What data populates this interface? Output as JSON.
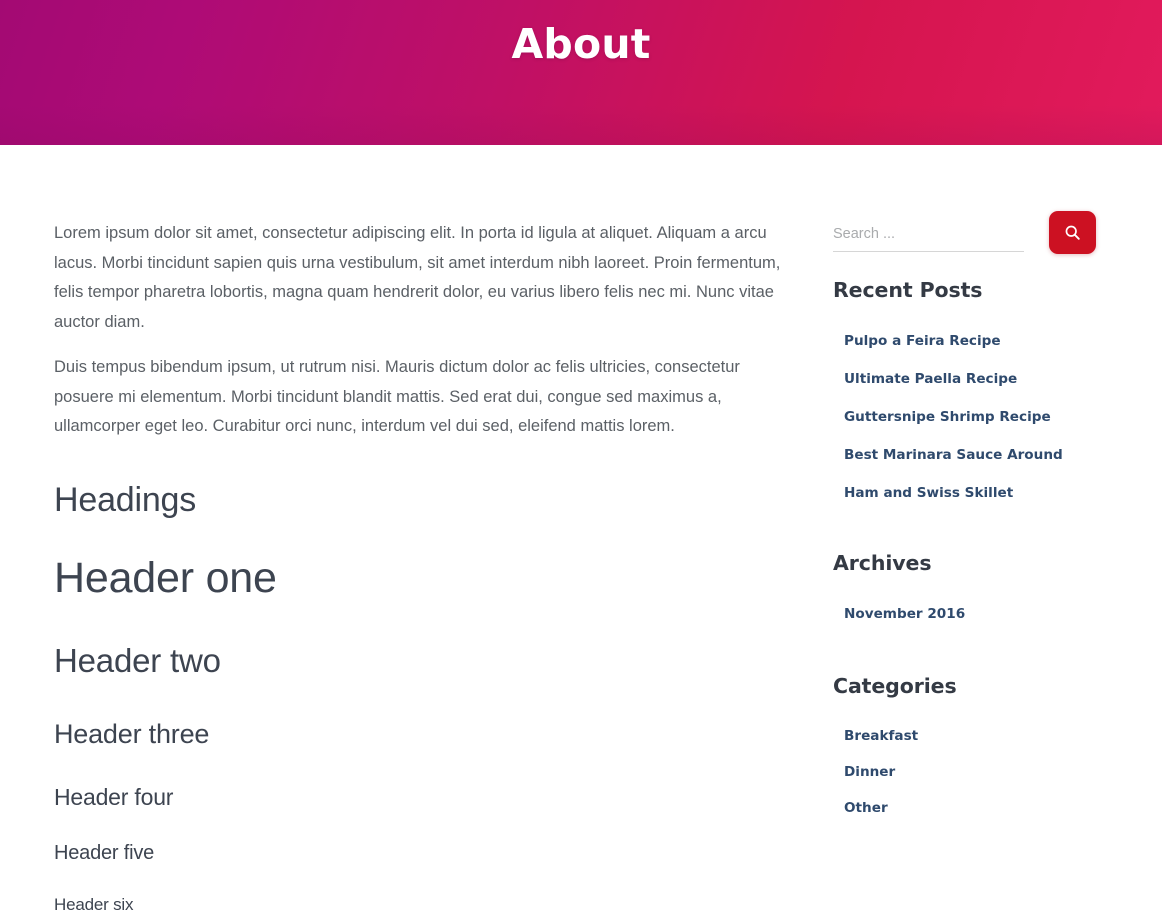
{
  "banner": {
    "title": "About",
    "gradient_start": "#a30a73",
    "gradient_end": "#e21a5c"
  },
  "main": {
    "paragraphs": [
      "Lorem ipsum dolor sit amet, consectetur adipiscing elit. In porta id ligula at aliquet. Aliquam a arcu lacus. Morbi tincidunt sapien quis urna vestibulum, sit amet interdum nibh laoreet. Proin fermentum, felis tempor pharetra lobortis, magna quam hendrerit dolor, eu varius libero felis nec mi. Nunc vitae auctor diam.",
      "Duis tempus bibendum ipsum, ut rutrum nisi. Mauris dictum dolor ac felis ultricies, consectetur posuere mi elementum. Morbi tincidunt blandit mattis. Sed erat dui, congue sed maximus a, ullamcorper eget leo. Curabitur orci nunc, interdum vel dui sed, eleifend mattis lorem."
    ],
    "headings_section_title": "Headings",
    "headers": {
      "one": "Header one",
      "two": "Header two",
      "three": "Header three",
      "four": "Header four",
      "five": "Header five",
      "six": "Header six"
    }
  },
  "sidebar": {
    "search": {
      "placeholder": "Search ...",
      "value": "",
      "button_icon": "search-icon",
      "button_color": "#cc1122"
    },
    "recent_posts": {
      "title": "Recent Posts",
      "items": [
        "Pulpo a Feira Recipe",
        "Ultimate Paella Recipe",
        "Guttersnipe Shrimp Recipe",
        "Best Marinara Sauce Around",
        "Ham and Swiss Skillet"
      ]
    },
    "archives": {
      "title": "Archives",
      "items": [
        "November 2016"
      ]
    },
    "categories": {
      "title": "Categories",
      "items": [
        "Breakfast",
        "Dinner",
        "Other"
      ]
    }
  },
  "colors": {
    "link": "#2f4a6d",
    "heading": "#343a44",
    "body_text": "#5b6066",
    "accent": "#cc1122"
  }
}
